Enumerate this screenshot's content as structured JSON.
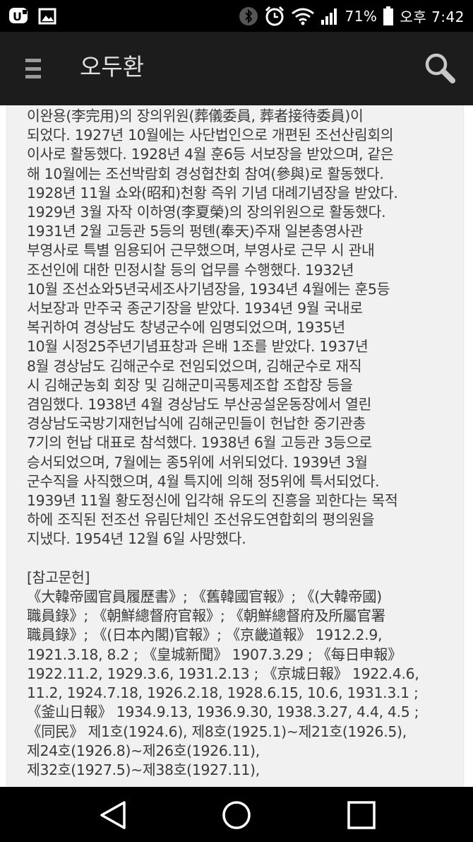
{
  "status_bar": {
    "battery": "71%",
    "time": "오후 7:42",
    "icons": [
      "u-plus-icon",
      "gallery-icon",
      "bluetooth-icon",
      "alarm-icon",
      "wifi-icon",
      "signal-icon",
      "battery-icon"
    ]
  },
  "app_bar": {
    "title": "오두환",
    "menu_icon": "menu-icon",
    "search_icon": "search-icon"
  },
  "content": {
    "lines": [
      "이완용(李完用)의 장의위원(葬儀委員, 葬者接待委員)이",
      "되었다. 1927년 10월에는 사단법인으로 개편된 조선산림회의",
      "이사로 활동했다. 1928년 4월 훈6등 서보장을 받았으며, 같은",
      "해 10월에는 조선박람회 경성협찬회 참여(參與)로 활동했다.",
      "1928년 11월 쇼와(昭和)천황 즉위 기념 대례기념장을 받았다.",
      "1929년 3월 자작 이하영(李夏榮)의 장의위원으로 활동했다.",
      "1931년 2월 고등관 5등의 펑톈(奉天)주재 일본총영사관",
      "부영사로 특별 임용되어 근무했으며, 부영사로 근무 시 관내",
      "조선인에 대한 민정시찰 등의 업무를 수행했다. 1932년",
      "10월 조선쇼와5년국세조사기념장을, 1934년 4월에는 훈5등",
      "서보장과 만주국 종군기장을 받았다. 1934년 9월 국내로",
      "복귀하여 경상남도 창녕군수에 임명되었으며, 1935년",
      "10월 시정25주년기념표창과 은배 1조를 받았다. 1937년",
      "8월 경상남도 김해군수로 전임되었으며, 김해군수로 재직",
      "시 김해군농회 회장 및 김해군미곡통제조합 조합장 등을",
      "겸임했다. 1938년 4월 경상남도 부산공설운동장에서 열린",
      "경상남도국방기재헌납식에 김해군민들이 헌납한 중기관총",
      "7기의 헌납 대표로 참석했다. 1938년 6월 고등관 3등으로",
      "승서되었으며, 7월에는 종5위에 서위되었다. 1939년 3월",
      "군수직을 사직했으며, 4월 특지에 의해 정5위에 특서되었다.",
      "1939년 11월 황도정신에 입각해 유도의 진흥을 꾀한다는 목적",
      "하에 조직된 전조선 유림단체인 조선유도연합회의 평의원을",
      "지냈다. 1954년 12월 6일 사망했다.",
      "",
      "[참고문헌]",
      "《大韓帝國官員履歷書》; 《舊韓國官報》; 《(大韓帝國)",
      "職員錄》; 《朝鮮總督府官報》; 《朝鮮總督府及所屬官署",
      "職員錄》; 《(日本內閣)官報》; 《京畿道報》 1912.2.9,",
      "1921.3.18, 8.2 ; 《皇城新聞》 1907.3.29 ; 《每日申報》",
      "1922.11.2, 1929.3.6, 1931.2.13 ; 《京城日報》 1922.4.6,",
      "11.2, 1924.7.18, 1926.2.18, 1928.6.15, 10.6, 1931.3.1 ;",
      "《釜山日報》 1934.9.13, 1936.9.30, 1938.3.27, 4.4, 4.5 ;",
      "《同民》 제1호(1924.6), 제8호(1925.1)~제21호(1926.5),",
      "제24호(1926.8)~제26호(1926.11),",
      "제32호(1927.5)~제38호(1927.11),"
    ]
  },
  "nav_bar": {
    "back_icon": "back-triangle-icon",
    "home_icon": "home-circle-icon",
    "recents_icon": "recents-square-icon"
  }
}
